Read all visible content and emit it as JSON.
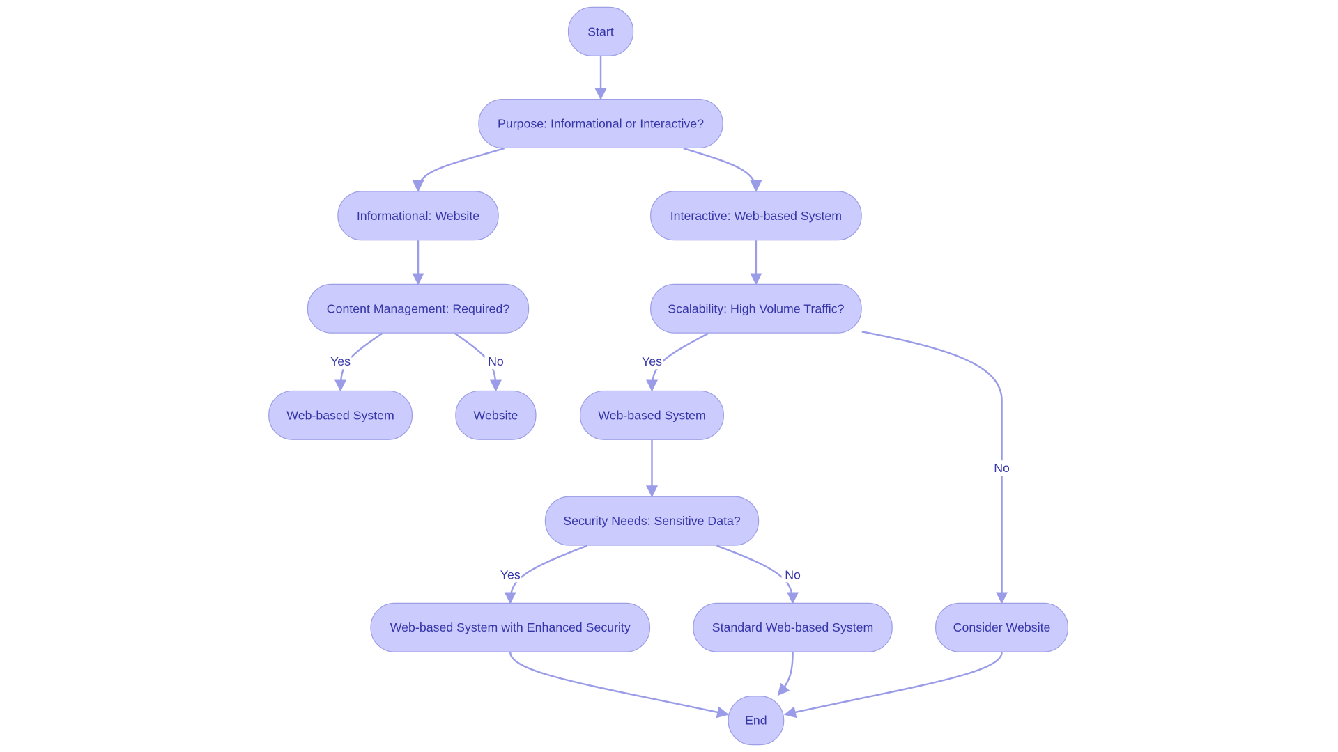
{
  "colors": {
    "node_fill": "#cbccfd",
    "node_stroke": "#9c9ee6",
    "edge": "#9a9ce8",
    "text": "#3535a8"
  },
  "nodes": {
    "start": "Start",
    "purpose": "Purpose: Informational or Interactive?",
    "informational": "Informational: Website",
    "interactive": "Interactive: Web-based System",
    "content": "Content Management: Required?",
    "scalability": "Scalability: High Volume Traffic?",
    "wbs1": "Web-based System",
    "website": "Website",
    "wbs2": "Web-based System",
    "security": "Security Needs: Sensitive Data?",
    "enhanced": "Web-based System with Enhanced Security",
    "standard": "Standard Web-based System",
    "consider": "Consider Website",
    "end": "End"
  },
  "edge_labels": {
    "content_yes": "Yes",
    "content_no": "No",
    "scal_yes": "Yes",
    "scal_no": "No",
    "sec_yes": "Yes",
    "sec_no": "No"
  }
}
